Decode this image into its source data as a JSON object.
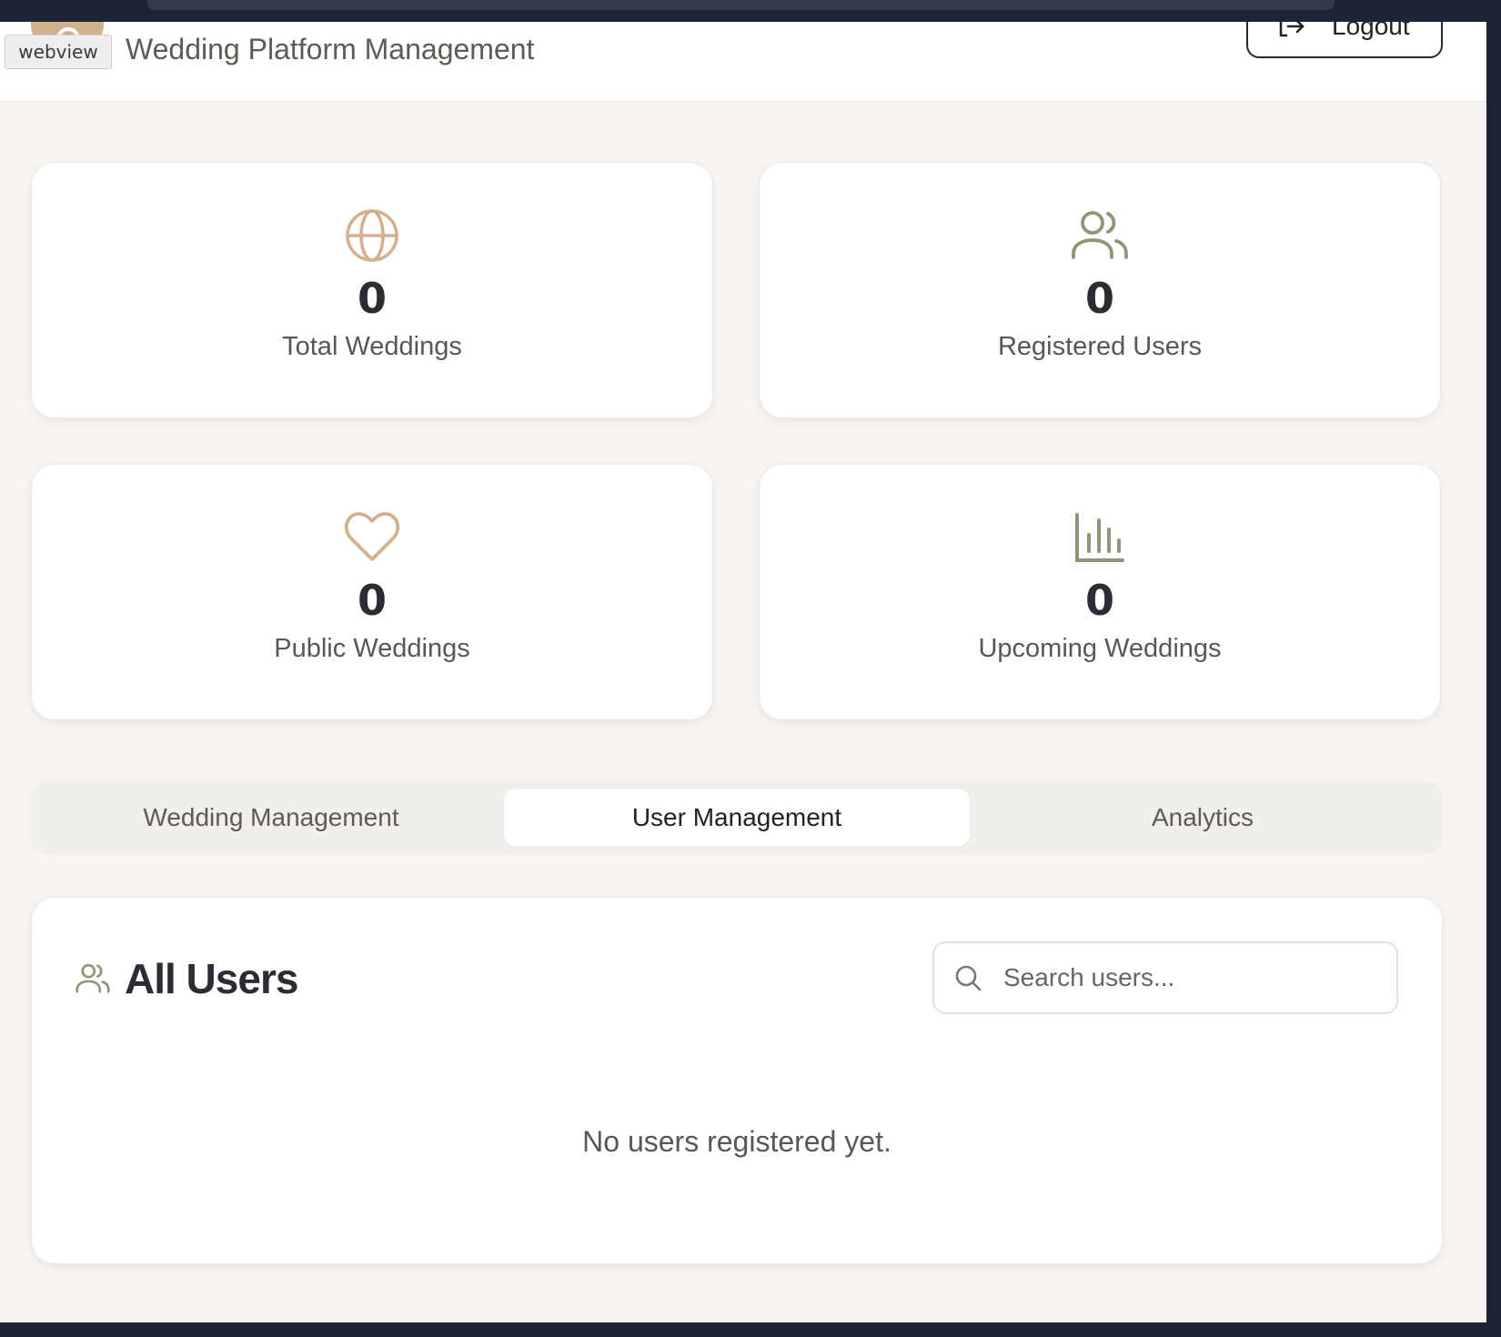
{
  "overlay": {
    "webview_label": "webview"
  },
  "header": {
    "title": "Wedding Platform Management",
    "logout_label": "Logout"
  },
  "stats": [
    {
      "icon": "globe-icon",
      "value": "0",
      "label": "Total Weddings"
    },
    {
      "icon": "users-icon",
      "value": "0",
      "label": "Registered Users"
    },
    {
      "icon": "heart-icon",
      "value": "0",
      "label": "Public Weddings"
    },
    {
      "icon": "bar-chart-icon",
      "value": "0",
      "label": "Upcoming Weddings"
    }
  ],
  "tabs": [
    {
      "label": "Wedding Management",
      "active": false
    },
    {
      "label": "User Management",
      "active": true
    },
    {
      "label": "Analytics",
      "active": false
    }
  ],
  "users_panel": {
    "title": "All Users",
    "search_placeholder": "Search users...",
    "search_value": "",
    "empty_message": "No users registered yet."
  },
  "colors": {
    "accent_tan": "#d2b18f",
    "accent_sage": "#8e9678",
    "page_bg": "#f7f4f2",
    "text_dark": "#2a2d33"
  }
}
